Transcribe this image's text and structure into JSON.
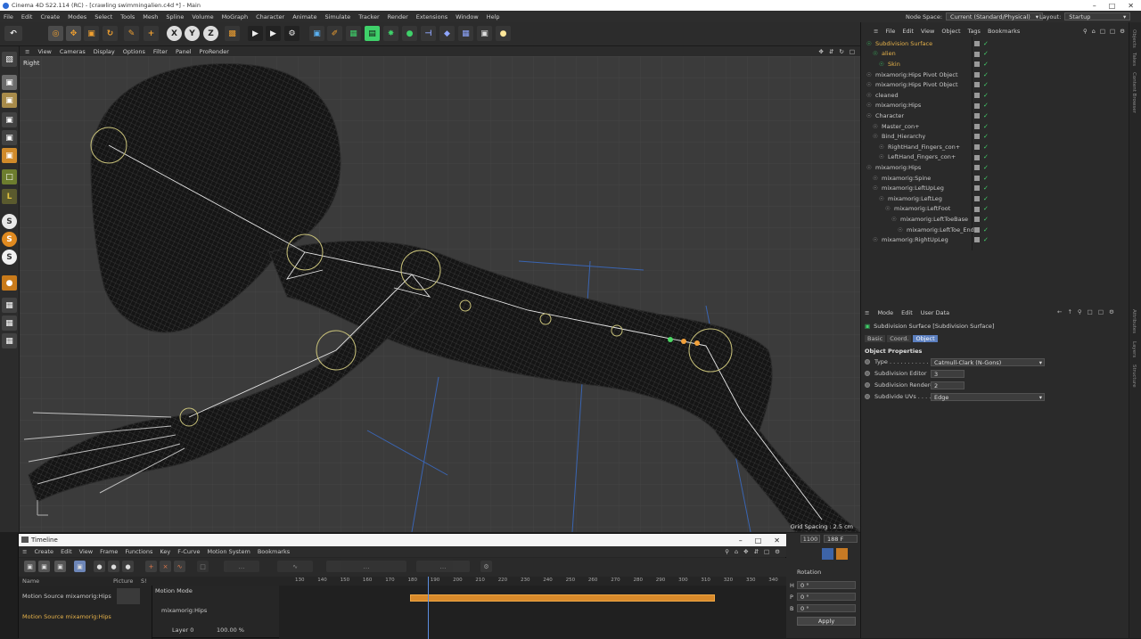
{
  "title_bar": {
    "text": "Cinema 4D S22.114 (RC) - [crawling swimmingalien.c4d *] - Main"
  },
  "menu": [
    "File",
    "Edit",
    "Create",
    "Modes",
    "Select",
    "Tools",
    "Mesh",
    "Spline",
    "Volume",
    "MoGraph",
    "Character",
    "Animate",
    "Simulate",
    "Tracker",
    "Render",
    "Extensions",
    "Window",
    "Help"
  ],
  "node_space": {
    "label": "Node Space:",
    "value": "Current (Standard/Physical)"
  },
  "layout": {
    "label": "Layout:",
    "value": "Startup"
  },
  "viewport": {
    "menu": [
      "View",
      "Cameras",
      "Display",
      "Options",
      "Filter",
      "Panel",
      "ProRender"
    ],
    "label": "Right",
    "grid_spacing": "Grid Spacing : 2.5 cm"
  },
  "object_manager": {
    "menu": [
      "File",
      "Edit",
      "View",
      "Object",
      "Tags",
      "Bookmarks"
    ],
    "objects": [
      {
        "name": "Subdivision Surface",
        "indent": 0,
        "hl": true
      },
      {
        "name": "alien",
        "indent": 1,
        "hl": true
      },
      {
        "name": "Skin",
        "indent": 2,
        "hl": true
      },
      {
        "name": "mixamorig:Hips Pivot Object",
        "indent": 0,
        "hl": false
      },
      {
        "name": "mixamorig:Hips Pivot Object",
        "indent": 0,
        "hl": false
      },
      {
        "name": "cleaned",
        "indent": 0,
        "hl": false
      },
      {
        "name": "mixamorig:Hips",
        "indent": 0,
        "hl": false
      },
      {
        "name": "Character",
        "indent": 0,
        "hl": false
      },
      {
        "name": "Master_con+",
        "indent": 1,
        "hl": false
      },
      {
        "name": "Bind_Hierarchy",
        "indent": 1,
        "hl": false
      },
      {
        "name": "RightHand_Fingers_con+",
        "indent": 2,
        "hl": false
      },
      {
        "name": "LeftHand_Fingers_con+",
        "indent": 2,
        "hl": false
      },
      {
        "name": "mixamorig:Hips",
        "indent": 0,
        "hl": false
      },
      {
        "name": "mixamorig:Spine",
        "indent": 1,
        "hl": false
      },
      {
        "name": "mixamorig:LeftUpLeg",
        "indent": 1,
        "hl": false
      },
      {
        "name": "mixamorig:LeftLeg",
        "indent": 2,
        "hl": false
      },
      {
        "name": "mixamorig:LeftFoot",
        "indent": 3,
        "hl": false
      },
      {
        "name": "mixamorig:LeftToeBase",
        "indent": 4,
        "hl": false
      },
      {
        "name": "mixamorig:LeftToe_End",
        "indent": 5,
        "hl": false
      },
      {
        "name": "mixamorig:RightUpLeg",
        "indent": 1,
        "hl": false
      }
    ]
  },
  "attributes": {
    "menu": [
      "Mode",
      "Edit",
      "User Data"
    ],
    "header": "Subdivision Surface [Subdivision Surface]",
    "tabs": [
      "Basic",
      "Coord.",
      "Object"
    ],
    "active_tab": "Object",
    "section": "Object Properties",
    "props": [
      {
        "label": "Type . . . . . . . . . . . .",
        "value": "Catmull-Clark (N-Gons)",
        "kind": "dropdown"
      },
      {
        "label": "Subdivision Editor",
        "value": "3",
        "kind": "num"
      },
      {
        "label": "Subdivision Renderer",
        "value": "2",
        "kind": "num"
      },
      {
        "label": "Subdivide UVs . . . .",
        "value": "Edge",
        "kind": "dropdown"
      }
    ]
  },
  "side_tabs": [
    "Objects",
    "Takes",
    "Content Browser",
    "Attributes",
    "Layers",
    "Structure"
  ],
  "timeline": {
    "title": "Timeline",
    "menu": [
      "Create",
      "Edit",
      "View",
      "Frame",
      "Functions",
      "Key",
      "F-Curve",
      "Motion System",
      "Bookmarks"
    ],
    "columns": {
      "name": "Name",
      "picture": "Picture",
      "s": "S!"
    },
    "ticks": [
      "130",
      "140",
      "150",
      "160",
      "170",
      "180",
      "190",
      "200",
      "210",
      "220",
      "230",
      "240",
      "250",
      "260",
      "270",
      "280",
      "290",
      "300",
      "310",
      "320",
      "330",
      "340"
    ],
    "rows": [
      {
        "name": "Motion Source mixamorig:Hips",
        "hl": false
      },
      {
        "name": "Motion Source mixamorig:Hips",
        "hl": true
      }
    ],
    "motion_mode": "Motion Mode",
    "layer_hips": "mixamorig:Hips",
    "layer": "Layer 0",
    "layer_pct": "100.00 %",
    "current_frame": "188 F",
    "end_frame": "1100"
  },
  "coords": {
    "title": "Rotation",
    "rows": [
      {
        "k": "H",
        "v": "0 °"
      },
      {
        "k": "P",
        "v": "0 °"
      },
      {
        "k": "B",
        "v": "0 °"
      }
    ],
    "apply": "Apply"
  },
  "colors": {
    "accent": "#e6b24a",
    "check": "#45d26b",
    "bar": "#d98a2b",
    "playhead": "#5b8ee0"
  }
}
